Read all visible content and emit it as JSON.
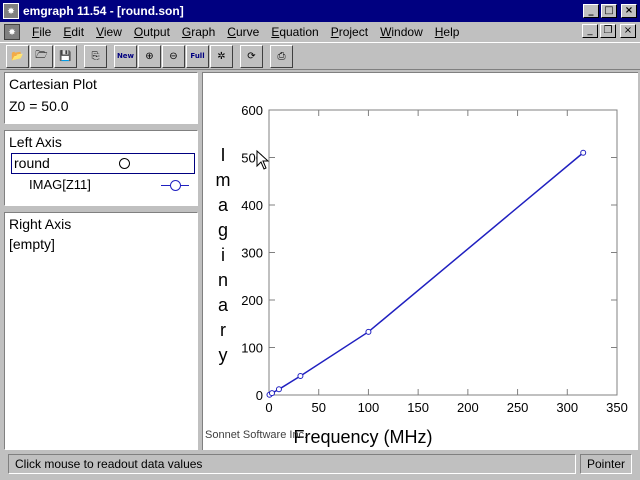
{
  "window": {
    "title": "emgraph 11.54 - [round.son]"
  },
  "menu": [
    "File",
    "Edit",
    "View",
    "Output",
    "Graph",
    "Curve",
    "Equation",
    "Project",
    "Window",
    "Help"
  ],
  "toolbar": {
    "new_label": "New",
    "full_label": "Full"
  },
  "left_panel": {
    "plot_type": "Cartesian Plot",
    "z0": "Z0 = 50.0",
    "left_axis_title": "Left Axis",
    "file_name": "round",
    "curve_name": "IMAG[Z11]",
    "right_axis_title": "Right Axis",
    "right_axis_value": "[empty]"
  },
  "colors": {
    "curve": "#2020c0",
    "title_bar": "#000080"
  },
  "chart_data": {
    "type": "line",
    "xlabel": "Frequency (MHz)",
    "ylabel": "Imaginary",
    "xlim": [
      0,
      350
    ],
    "ylim": [
      0,
      600
    ],
    "xticks": [
      "0",
      "50",
      "100",
      "150",
      "200",
      "250",
      "300",
      "350"
    ],
    "yticks": [
      "0",
      "100",
      "200",
      "300",
      "400",
      "500",
      "600"
    ],
    "series": [
      {
        "x": [
          0.5,
          3,
          10,
          31.6,
          100,
          316
        ],
        "y": [
          0.5,
          4,
          12,
          40,
          133,
          510
        ]
      }
    ],
    "footer": "Sonnet Software Inc.",
    "grid": false
  },
  "status": {
    "message": "Click mouse to readout data values",
    "mode": "Pointer"
  }
}
